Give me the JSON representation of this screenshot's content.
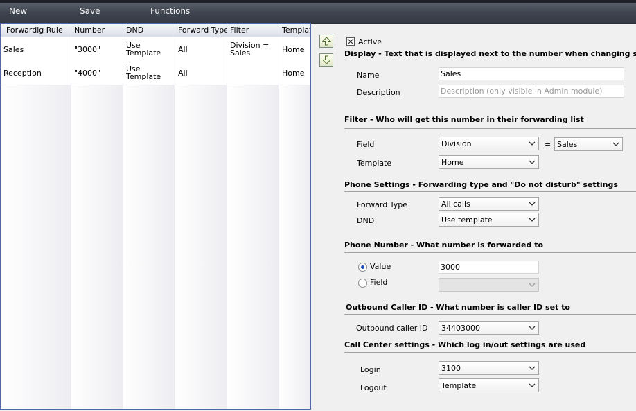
{
  "toolbar": {
    "new_label": "New",
    "save_label": "Save",
    "functions_label": "Functions"
  },
  "grid": {
    "columns": [
      "Forwardig Rule",
      "Number",
      "DND",
      "Forward Type",
      "Filter",
      "Template"
    ],
    "rows": [
      {
        "rule": "Sales",
        "number": "\"3000\"",
        "dnd": "Use Template",
        "forward_type": "All",
        "filter": "Division = Sales",
        "template": "Home"
      },
      {
        "rule": "Reception",
        "number": "\"4000\"",
        "dnd": "Use Template",
        "forward_type": "All",
        "filter": "",
        "template": "Home"
      }
    ]
  },
  "form": {
    "active_label": "Active",
    "active_checked": true,
    "display": {
      "header": "Display - Text that is displayed next to the number when changing state",
      "name_label": "Name",
      "name_value": "Sales",
      "description_label": "Description",
      "description_placeholder": "Description (only visible in Admin module)"
    },
    "filter": {
      "header": "Filter - Who will get this number in their forwarding list",
      "field_label": "Field",
      "field_value": "Division",
      "equals": "=",
      "match_value": "Sales",
      "template_label": "Template",
      "template_value": "Home"
    },
    "phone": {
      "header": "Phone Settings - Forwarding type and \"Do not disturb\" settings",
      "forward_type_label": "Forward Type",
      "forward_type_value": "All calls",
      "dnd_label": "DND",
      "dnd_value": "Use template"
    },
    "number": {
      "header": "Phone Number - What number is forwarded to",
      "value_label": "Value",
      "value_value": "3000",
      "field_label": "Field",
      "field_value": ""
    },
    "caller_id": {
      "header": "Outbound Caller ID - What number is caller ID set to",
      "label": "Outbound caller ID",
      "value": "34403000"
    },
    "call_center": {
      "header": "Call Center settings - Which log in/out settings are used",
      "login_label": "Login",
      "login_value": "3100",
      "logout_label": "Logout",
      "logout_value": "Template"
    }
  }
}
